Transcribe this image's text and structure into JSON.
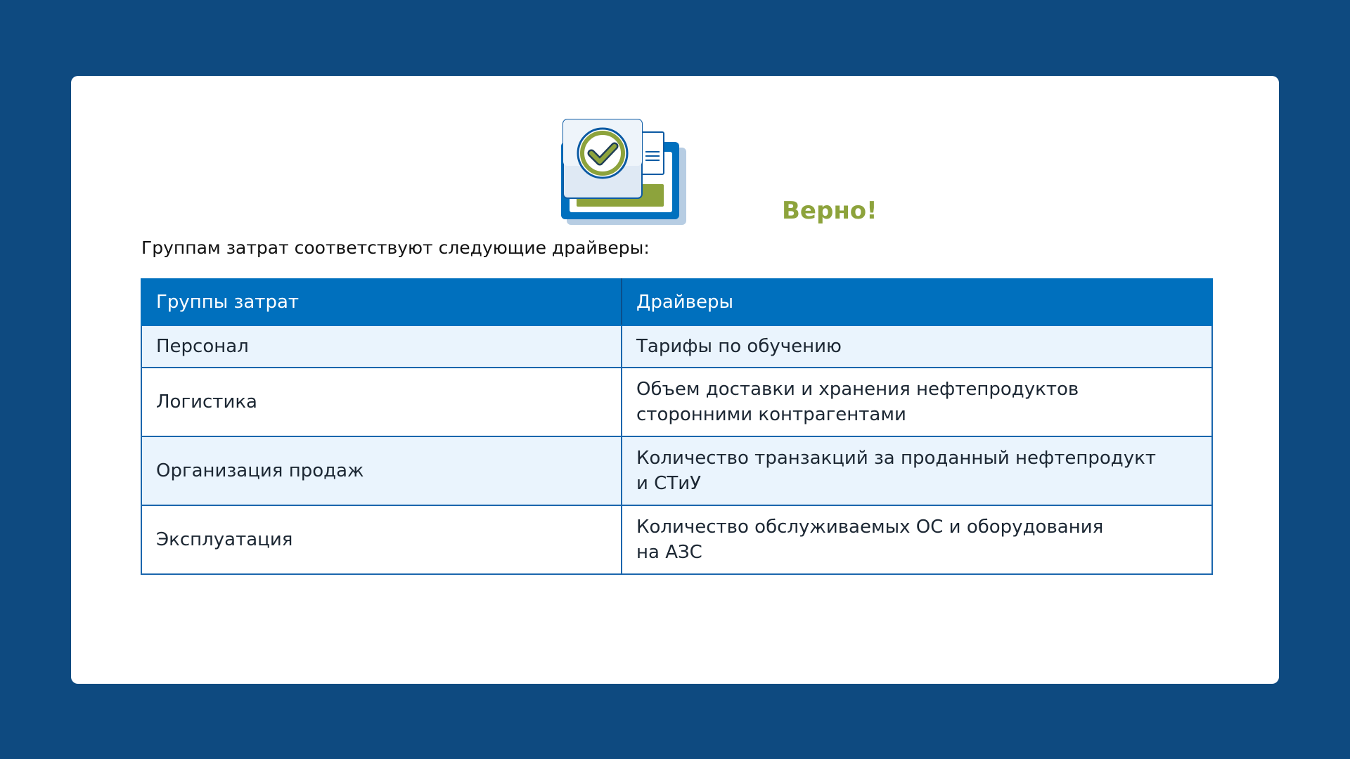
{
  "feedback": {
    "title": "Верно!",
    "icon": "check-document-illustration",
    "colors": {
      "accent_green": "#8da33c",
      "primary_blue": "#0070be",
      "background_navy": "#0e4a80"
    }
  },
  "intro": {
    "text": "Группам затрат соответствуют следующие драйверы:"
  },
  "table": {
    "headers": [
      "Группы затрат",
      "Драйверы"
    ],
    "rows": [
      {
        "group": "Персонал",
        "driver_line1": "Тарифы по обучению",
        "driver_line2": ""
      },
      {
        "group": "Логистика",
        "driver_line1": "Объем доставки и хранения нефтепродуктов",
        "driver_line2": "сторонними контрагентами"
      },
      {
        "group": "Организация продаж",
        "driver_line1": "Количество транзакций за проданный нефтепродукт",
        "driver_line2": "и СТиУ"
      },
      {
        "group": "Эксплуатация",
        "driver_line1": "Количество обслуживаемых ОС и оборудования",
        "driver_line2": "на АЗС"
      }
    ]
  }
}
